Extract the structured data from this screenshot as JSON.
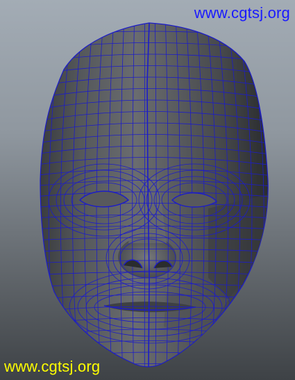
{
  "watermarks": {
    "top": "www.cgtsj.org",
    "bottom": "www.cgtsj.org"
  },
  "colors": {
    "watermark_top": "#1a1aff",
    "watermark_bottom": "#ffff00",
    "wireframe": "#1c1cc8",
    "mesh_light": "#6a6c6f",
    "mesh_dark": "#2a2c2e"
  },
  "viewport": {
    "content": "polygon-mesh-face",
    "display_mode": "shaded-with-wireframe"
  }
}
